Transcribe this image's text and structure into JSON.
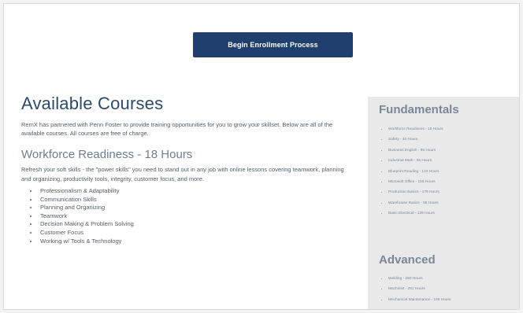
{
  "enroll_button": {
    "label": "Begin Enrollment Process"
  },
  "main": {
    "title": "Available Courses",
    "intro": "RemX has partnered with Penn Foster to provide training opportunities for you to grow your skillset. Below are all of the available courses. All courses are free of charge.",
    "section": {
      "title": "Workforce Readiness - 18 Hours",
      "description": "Refresh your soft skills - the \"power skills\" you need to stand out in any job with online lessons covering teamwork, planning and organizing, productivity tools, integrity, customer focus, and more.",
      "topics": [
        "Professionalism & Adaptability",
        "Communication Skills",
        "Planning and Organizing",
        "Teamwork",
        "Decision Making & Problem Solving",
        "Customer Focus",
        "Working w/ Tools & Technology"
      ]
    }
  },
  "sidebar": {
    "fundamentals": {
      "heading": "Fundamentals",
      "items": [
        "Workforce Readiness - 18 Hours",
        "Safety - 40 Hours",
        "Business English - 86 Hours",
        "Industrial Math - 55 Hours",
        "Blueprint Reading - 124 Hours",
        "Microsoft Office - 155 Hours",
        "Production Basics - 179 Hours",
        "Warehouse Basics - 85 Hours",
        "Basic Electrical - 129 Hours"
      ]
    },
    "advanced": {
      "heading": "Advanced",
      "items": [
        "Welding - 250 Hours",
        "Machinist - 261 Hours",
        "Mechanical Maintenance - 195 Hours"
      ]
    }
  },
  "colors": {
    "button_bg": "#1f3f6e",
    "title": "#2d4a6b",
    "section_title": "#6f7d8f",
    "sidebar_bg": "#e9e9e9"
  }
}
